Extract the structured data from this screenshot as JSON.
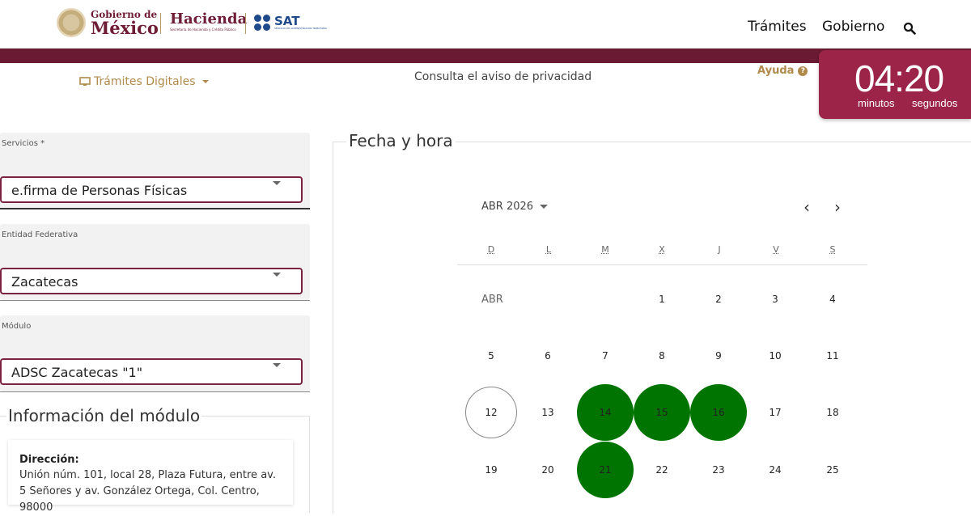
{
  "header": {
    "gob_small": "Gobierno de",
    "gob_big": "México",
    "hacienda_title": "Hacienda",
    "hacienda_sub": "Secretaría de Hacienda y Crédito Público",
    "sat_name": "SAT",
    "sat_sub": "SERVICIO DE ADMINISTRACIÓN TRIBUTARIA",
    "nav": [
      "Trámites",
      "Gobierno"
    ]
  },
  "subnav": {
    "tramites": "Trámites Digitales",
    "aviso": "Consulta el aviso de privacidad",
    "ayuda": "Ayuda"
  },
  "timer": {
    "value": "04:20",
    "min_label": "minutos",
    "sec_label": "segundos"
  },
  "form": {
    "servicios_label": "Servicios *",
    "servicios_value": "e.firma de Personas Físicas",
    "entidad_label": "Entidad Federativa",
    "entidad_value": "Zacatecas",
    "modulo_label": "Módulo",
    "modulo_value": "ADSC Zacatecas \"1\""
  },
  "info": {
    "legend": "Información del módulo",
    "direccion_label": "Dirección:",
    "direccion_text": "Unión núm. 101, local 28, Plaza Futura, entre av. 5 Señores y av. González Ortega, Col. Centro, 98000"
  },
  "calendar": {
    "legend": "Fecha y hora",
    "month": "ABR 2026",
    "prev": "‹",
    "next": "›",
    "days_of_week": [
      "D",
      "L",
      "M",
      "X",
      "J",
      "V",
      "S"
    ],
    "month_label": "ABR",
    "today": 12,
    "available": [
      14,
      15,
      16,
      21
    ],
    "first_weekday": 3,
    "last_day_shown": 25
  },
  "colors": {
    "brand": "#6b1a34",
    "accent": "#9d2449",
    "gold": "#b08a4a",
    "available": "#007400"
  }
}
